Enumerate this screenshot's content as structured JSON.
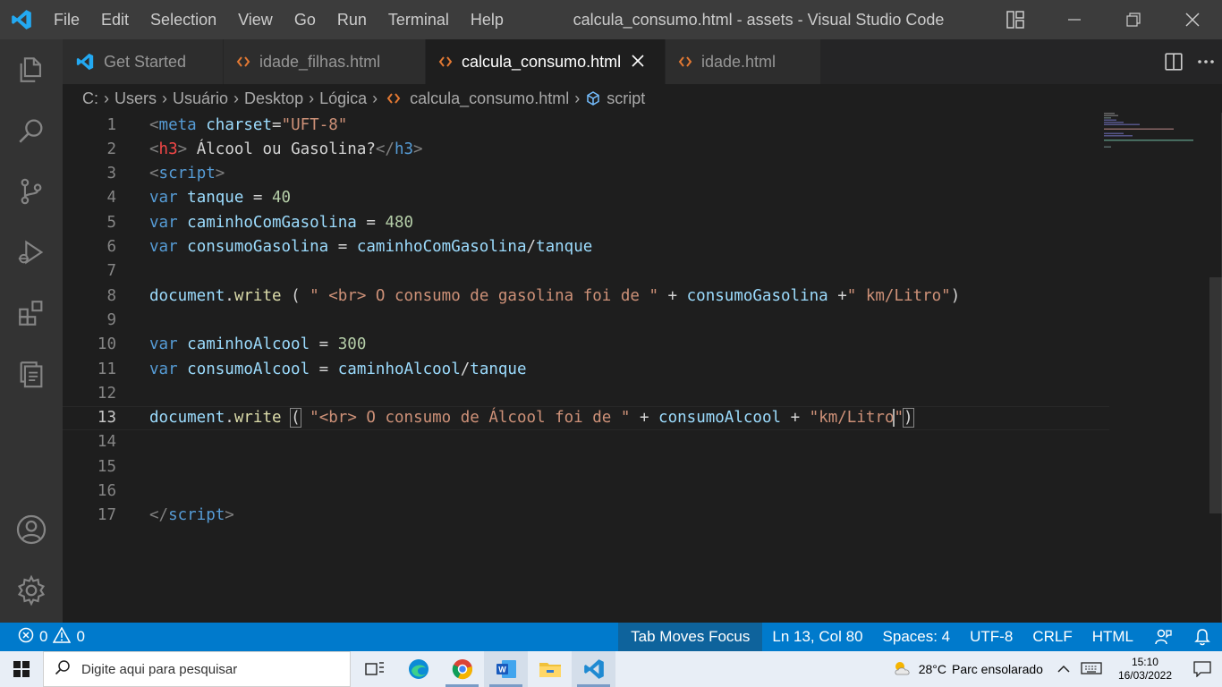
{
  "titlebar": {
    "menu": [
      "File",
      "Edit",
      "Selection",
      "View",
      "Go",
      "Run",
      "Terminal",
      "Help"
    ],
    "title": "calcula_consumo.html - assets - Visual Studio Code"
  },
  "tabs": [
    {
      "label": "Get Started",
      "icon": "vscode-logo-icon",
      "active": false
    },
    {
      "label": "idade_filhas.html",
      "icon": "html-icon",
      "active": false
    },
    {
      "label": "calcula_consumo.html",
      "icon": "html-icon",
      "active": true
    },
    {
      "label": "idade.html",
      "icon": "html-icon",
      "active": false
    }
  ],
  "breadcrumb": {
    "parts": [
      "C:",
      "Users",
      "Usuário",
      "Desktop",
      "Lógica",
      "calcula_consumo.html",
      "script"
    ]
  },
  "editor": {
    "line_numbers": [
      "1",
      "2",
      "3",
      "4",
      "5",
      "6",
      "7",
      "8",
      "9",
      "10",
      "11",
      "12",
      "13",
      "14",
      "15",
      "16",
      "17"
    ],
    "current_line": 13
  },
  "statusbar": {
    "errors": "0",
    "warnings": "0",
    "tab_focus": "Tab Moves Focus",
    "position": "Ln 13, Col 80",
    "spaces": "Spaces: 4",
    "encoding": "UTF-8",
    "eol": "CRLF",
    "language": "HTML"
  },
  "taskbar": {
    "search_placeholder": "Digite aqui para pesquisar",
    "temperature": "28°C",
    "weather": "Parc ensolarado",
    "time": "15:10",
    "date": "16/03/2022"
  },
  "colors": {
    "accent": "#007acc",
    "editor_bg": "#1e1e1e",
    "activity_bg": "#333333",
    "title_bg": "#3c3c3c"
  }
}
